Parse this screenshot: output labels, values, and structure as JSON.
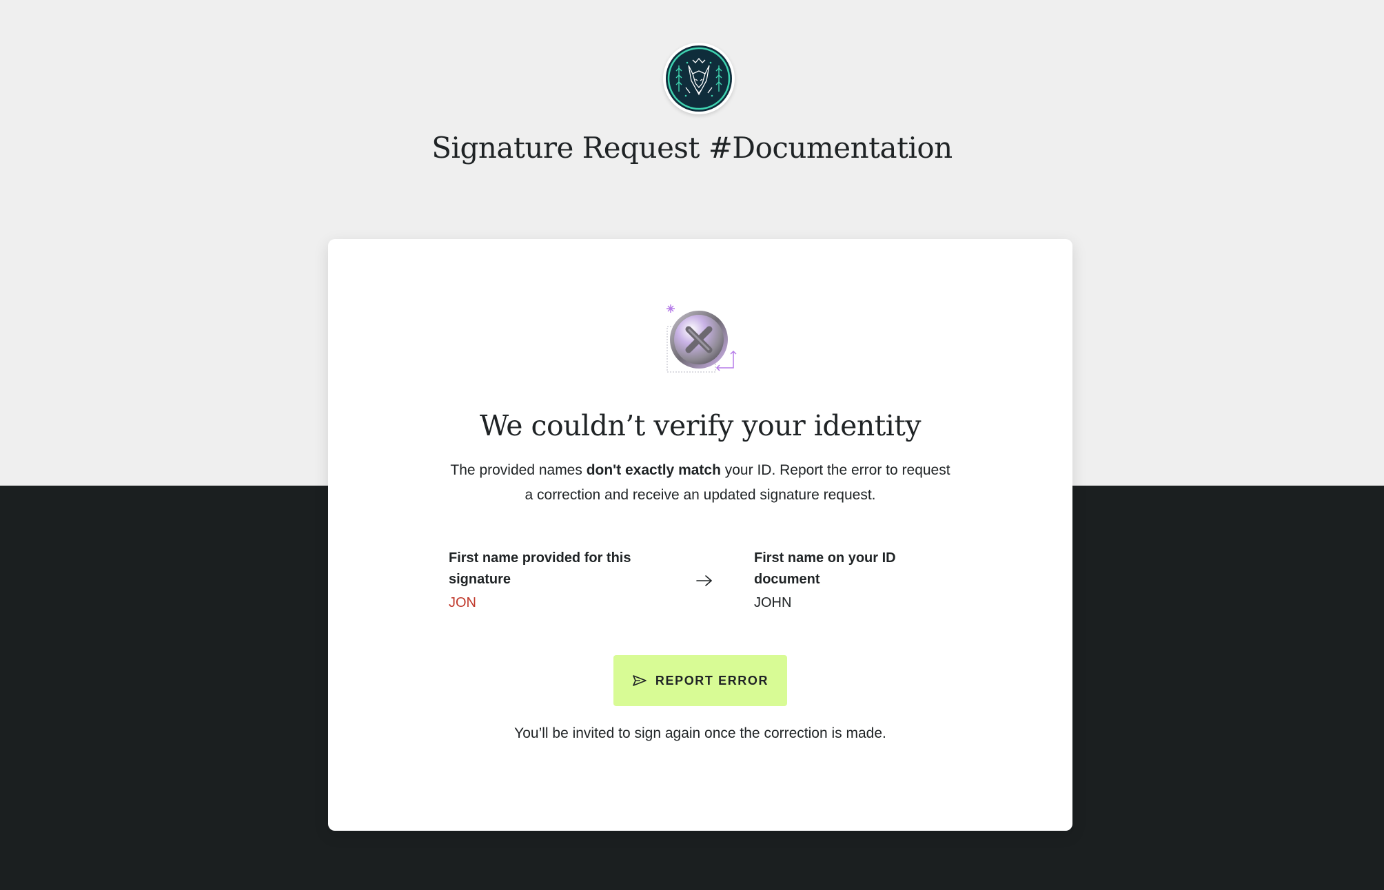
{
  "header": {
    "title": "Signature Request #Documentation"
  },
  "card": {
    "status_icon": "error-x-icon",
    "title": "We couldn’t verify your identity",
    "description": {
      "before": "The provided names ",
      "emphasis": "don't exactly match",
      "after": " your ID. Report the error to request a correction and receive an updated signature request."
    },
    "comparison": {
      "provided": {
        "label": "First name provided for this signature",
        "value": "JON"
      },
      "arrow_icon": "arrow-right-icon",
      "id_document": {
        "label": "First name on your ID document",
        "value": "JOHN"
      }
    },
    "report_button": {
      "icon": "send-icon",
      "label": "REPORT ERROR"
    },
    "footnote": "You’ll be invited to sign again once the correction is made."
  },
  "colors": {
    "top_background": "#efefef",
    "bottom_background": "#1b1f20",
    "card_background": "#ffffff",
    "button_background": "#d8fb95",
    "mismatch_text": "#c0392b",
    "logo_background": "#0f2d3b",
    "logo_accent": "#3ed3b0",
    "illustration_accent": "#b57be8"
  }
}
